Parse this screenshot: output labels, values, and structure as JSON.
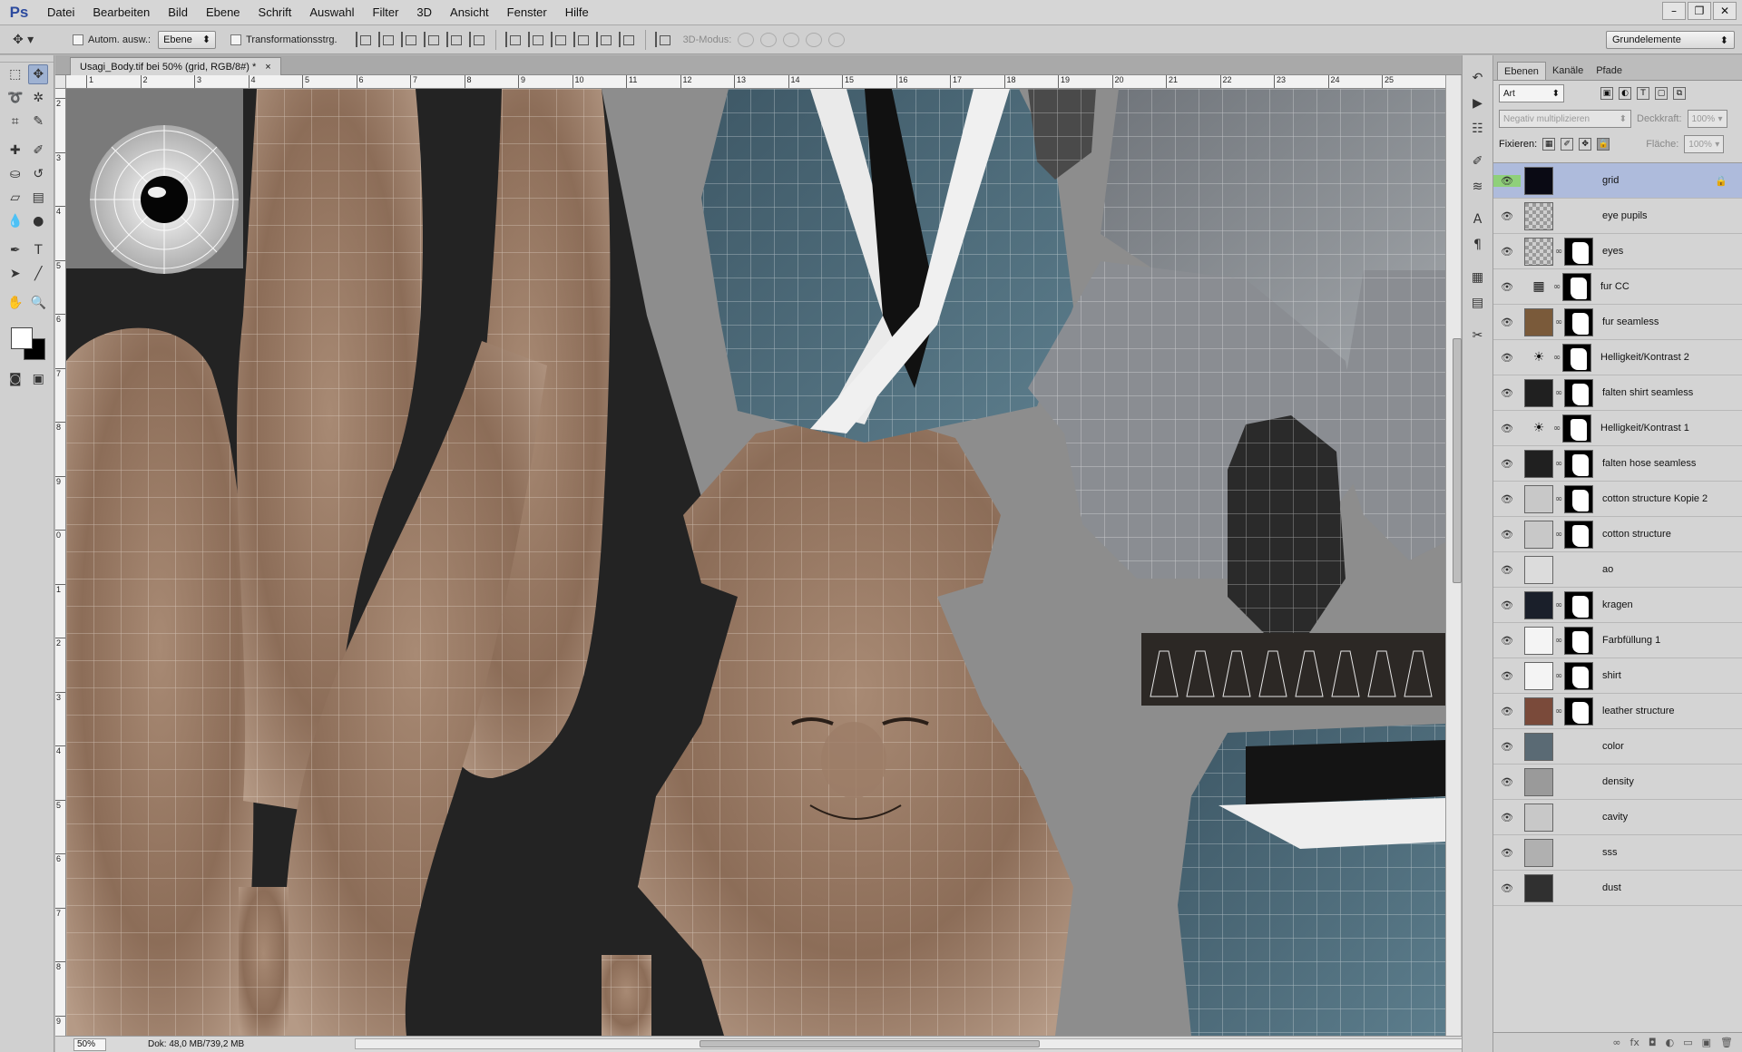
{
  "menubar": {
    "logo": "Ps",
    "items": [
      "Datei",
      "Bearbeiten",
      "Bild",
      "Ebene",
      "Schrift",
      "Auswahl",
      "Filter",
      "3D",
      "Ansicht",
      "Fenster",
      "Hilfe"
    ],
    "window_controls": [
      "–",
      "❐",
      "✕"
    ]
  },
  "options": {
    "auto_select_label": "Autom. ausw.:",
    "auto_select_value": "Ebene",
    "transform_label": "Transformationsstrg.",
    "mode_3d_label": "3D-Modus:",
    "workspace": "Grundelemente"
  },
  "document": {
    "tab_title": "Usagi_Body.tif bei 50% (grid, RGB/8#) *",
    "close": "×"
  },
  "rulers": {
    "horizontal": [
      "1",
      "2",
      "3",
      "4",
      "5",
      "6",
      "7",
      "8",
      "9",
      "10",
      "11",
      "12",
      "13",
      "14",
      "15",
      "16",
      "17",
      "18",
      "19",
      "20",
      "21",
      "22",
      "23",
      "24",
      "25"
    ],
    "vertical": [
      "2",
      "3",
      "4",
      "5",
      "6",
      "7",
      "8",
      "9",
      "0",
      "1",
      "2",
      "3",
      "4",
      "5",
      "6",
      "7",
      "8",
      "9"
    ]
  },
  "status": {
    "zoom": "50%",
    "doc_info": "Dok: 48,0 MB/739,2 MB"
  },
  "layers_panel": {
    "tabs": [
      "Ebenen",
      "Kanäle",
      "Pfade"
    ],
    "filter_kind": "Art",
    "blend_mode": "Negativ multiplizieren",
    "opacity_label": "Deckkraft:",
    "opacity_value": "100%",
    "lock_label": "Fixieren:",
    "fill_label": "Fläche:",
    "fill_value": "100%",
    "layers": [
      {
        "name": "grid",
        "selected": true,
        "thumb": "#0a0a14",
        "mask": false,
        "adj": ""
      },
      {
        "name": "eye pupils",
        "thumb": "checker",
        "mask": false,
        "adj": ""
      },
      {
        "name": "eyes",
        "thumb": "checker",
        "mask": true,
        "adj": ""
      },
      {
        "name": "fur CC",
        "thumb": "none",
        "mask": true,
        "adj": "▦"
      },
      {
        "name": "fur seamless",
        "thumb": "#7a5a3a",
        "mask": true,
        "adj": ""
      },
      {
        "name": "Helligkeit/Kontrast 2",
        "thumb": "none",
        "mask": true,
        "adj": "☀"
      },
      {
        "name": "falten shirt seamless",
        "thumb": "#202020",
        "mask": true,
        "adj": ""
      },
      {
        "name": "Helligkeit/Kontrast 1",
        "thumb": "none",
        "mask": true,
        "adj": "☀"
      },
      {
        "name": "falten hose seamless",
        "thumb": "#202020",
        "mask": true,
        "adj": ""
      },
      {
        "name": "cotton structure Kopie 2",
        "thumb": "#c8c8c8",
        "mask": true,
        "adj": ""
      },
      {
        "name": "cotton structure",
        "thumb": "#c8c8c8",
        "mask": true,
        "adj": ""
      },
      {
        "name": "ao",
        "thumb": "#dcdcdc",
        "mask": false,
        "adj": ""
      },
      {
        "name": "kragen",
        "thumb": "#1a1f2a",
        "mask": true,
        "adj": ""
      },
      {
        "name": "Farbfüllung 1",
        "thumb": "#f4f4f4",
        "mask": true,
        "adj": ""
      },
      {
        "name": "shirt",
        "thumb": "#f4f4f4",
        "mask": true,
        "adj": ""
      },
      {
        "name": "leather structure",
        "thumb": "#7a4a3a",
        "mask": true,
        "adj": ""
      },
      {
        "name": "color",
        "thumb": "#5a6a74",
        "mask": false,
        "adj": ""
      },
      {
        "name": "density",
        "thumb": "#9a9a9a",
        "mask": false,
        "adj": ""
      },
      {
        "name": "cavity",
        "thumb": "#c8c8c8",
        "mask": false,
        "adj": ""
      },
      {
        "name": "sss",
        "thumb": "#b0b0b0",
        "mask": false,
        "adj": ""
      },
      {
        "name": "dust",
        "thumb": "#303030",
        "mask": false,
        "adj": ""
      }
    ],
    "footer_icons": [
      "∞",
      "fx",
      "◘",
      "◐",
      "▭",
      "▣",
      "🗑"
    ]
  },
  "colors": {
    "fur": "#8a6a55",
    "fur_light": "#b89a85",
    "cloth_blue": "#4d6b7a",
    "cloth_gray": "#8a8e94",
    "canvas_bg": "#232323",
    "selection": "#aebbdc"
  }
}
